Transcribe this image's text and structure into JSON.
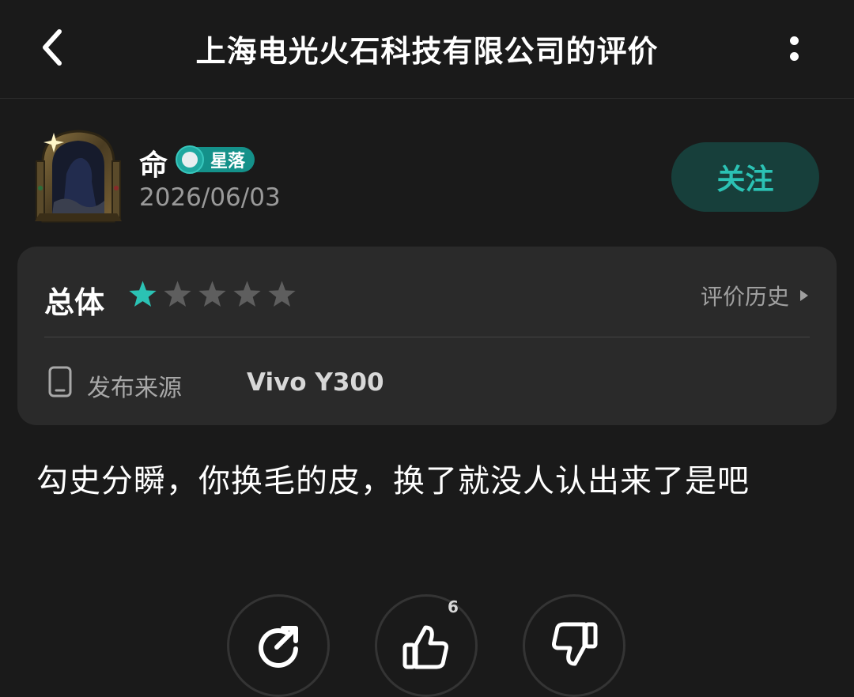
{
  "header": {
    "title": "上海电光火石科技有限公司的评价",
    "back_icon": "chevron-left-icon",
    "more_icon": "more-vertical-icon"
  },
  "author": {
    "name": "命",
    "badge": "星落",
    "date": "2026/06/03",
    "follow_label": "关注"
  },
  "rating": {
    "label": "总体",
    "stars_filled": 1,
    "stars_total": 5,
    "history_label": "评价历史",
    "source_label": "发布来源",
    "device": "Vivo Y300"
  },
  "review": {
    "text": "勾史分瞬，你换毛的皮，换了就没人认出来了是吧"
  },
  "actions": {
    "share_icon": "share-icon",
    "like_icon": "thumbs-up-icon",
    "like_count": "6",
    "dislike_icon": "thumbs-down-icon"
  },
  "colors": {
    "background": "#1a1a1a",
    "card": "#2a2a2a",
    "accent": "#2bc2b4",
    "follow_bg": "#173f3b",
    "star_filled": "#2bc2b4",
    "star_empty": "#5e5e5e"
  }
}
